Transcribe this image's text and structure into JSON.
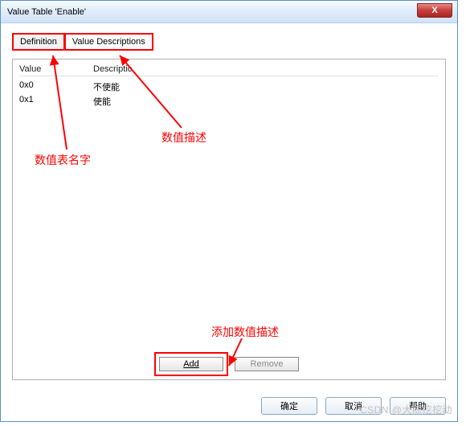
{
  "window": {
    "title": "Value Table 'Enable'",
    "close": "X"
  },
  "tabs": {
    "definition": "Definition",
    "valuedesc": "Value Descriptions"
  },
  "table": {
    "col_value": "Value",
    "col_desc": "Descriptic",
    "rows": [
      {
        "value": "0x0",
        "desc": "不使能"
      },
      {
        "value": "0x1",
        "desc": "使能"
      }
    ]
  },
  "buttons": {
    "add": "Add",
    "remove": "Remove"
  },
  "dialog": {
    "ok": "确定",
    "cancel": "取消",
    "help": "帮助"
  },
  "annotations": {
    "name": "数值表名字",
    "desc": "数值描述",
    "add": "添加数值描述"
  },
  "watermark": "CSDN @大陈挖挖动"
}
